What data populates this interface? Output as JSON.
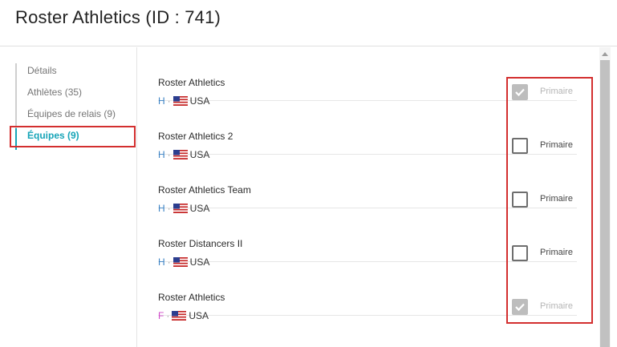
{
  "header": {
    "title": "Roster Athletics (ID : 741)"
  },
  "sidebar": {
    "items": [
      {
        "label": "Détails",
        "active": false
      },
      {
        "label": "Athlètes (35)",
        "active": false
      },
      {
        "label": "Équipes de relais (9)",
        "active": false
      },
      {
        "label": "Équipes (9)",
        "active": true
      }
    ]
  },
  "teams": [
    {
      "name": "Roster Athletics",
      "gender": "H",
      "separator": "·",
      "country": "USA",
      "flag": "us-flag-icon",
      "primary": true,
      "primary_label": "Primaire",
      "disabled": true
    },
    {
      "name": "Roster Athletics 2",
      "gender": "H",
      "separator": "·",
      "country": "USA",
      "flag": "us-flag-icon",
      "primary": false,
      "primary_label": "Primaire",
      "disabled": false
    },
    {
      "name": "Roster Athletics Team",
      "gender": "H",
      "separator": "·",
      "country": "USA",
      "flag": "us-flag-icon",
      "primary": false,
      "primary_label": "Primaire",
      "disabled": false
    },
    {
      "name": "Roster Distancers II",
      "gender": "H",
      "separator": "·",
      "country": "USA",
      "flag": "us-flag-icon",
      "primary": false,
      "primary_label": "Primaire",
      "disabled": false
    },
    {
      "name": "Roster Athletics",
      "gender": "F",
      "separator": "·",
      "country": "USA",
      "flag": "us-flag-icon",
      "primary": true,
      "primary_label": "Primaire",
      "disabled": true
    }
  ],
  "colors": {
    "accent": "#17a5b8",
    "highlight": "#d32f2f",
    "male": "#3b82c4",
    "female": "#d04ac9"
  }
}
